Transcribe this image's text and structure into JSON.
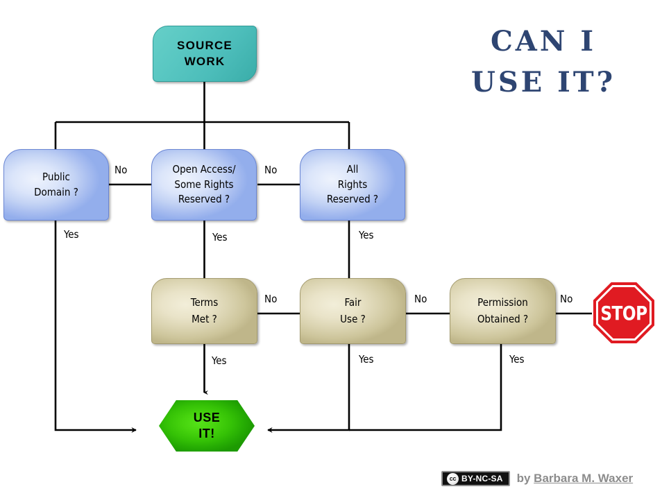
{
  "title": {
    "line1": "CAN I",
    "line2": "USE IT?",
    "color": "#2e4572"
  },
  "nodes": {
    "start": {
      "label_line1": "SOURCE",
      "label_line2": "WORK",
      "color": "#4cbdba"
    },
    "public_domain": {
      "label_line1": "Public",
      "label_line2": "Domain ?",
      "color": "#c2d2f4"
    },
    "open_access": {
      "label_line1": "Open Access/",
      "label_line2": "Some Rights",
      "label_line3": "Reserved ?",
      "color": "#c2d2f4"
    },
    "all_rights": {
      "label_line1": "All",
      "label_line2": "Rights",
      "label_line3": "Reserved ?",
      "color": "#c2d2f4"
    },
    "terms_met": {
      "label_line1": "Terms",
      "label_line2": "Met ?",
      "color": "#dad3b0"
    },
    "fair_use": {
      "label_line1": "Fair",
      "label_line2": "Use ?",
      "color": "#dad3b0"
    },
    "permission": {
      "label_line1": "Permission",
      "label_line2": "Obtained ?",
      "color": "#dad3b0"
    },
    "use_it": {
      "label_line1": "USE",
      "label_line2": "IT!",
      "color": "#35c206"
    },
    "stop": {
      "label": "STOP",
      "color": "#e01b22"
    }
  },
  "edge_labels": {
    "no_public_to_open": "No",
    "no_open_to_all": "No",
    "no_terms_to_fair": "No",
    "no_fair_to_permission": "No",
    "no_permission_to_stop": "No",
    "yes_public_domain": "Yes",
    "yes_open_access": "Yes",
    "yes_all_rights": "Yes",
    "yes_terms_met": "Yes",
    "yes_fair_use": "Yes",
    "yes_permission": "Yes"
  },
  "footer": {
    "cc_mark": "cc",
    "cc_terms": "BY-NC-SA",
    "by_prefix": "by ",
    "author": "Barbara M. Waxer"
  }
}
